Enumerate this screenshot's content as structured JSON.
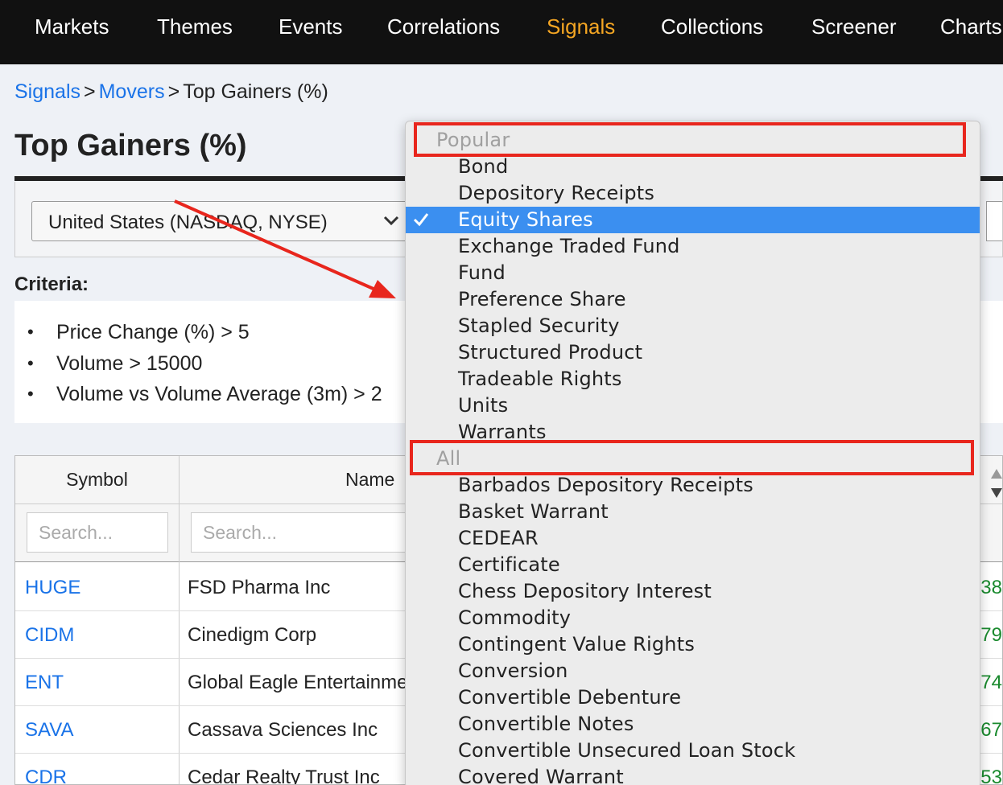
{
  "nav": {
    "items": [
      "Markets",
      "Themes",
      "Events",
      "Correlations",
      "Signals",
      "Collections",
      "Screener",
      "Charts"
    ],
    "active": "Signals",
    "active_color": "#f5a623"
  },
  "breadcrumb": {
    "signals": "Signals",
    "movers": "Movers",
    "sep": ">",
    "current": "Top Gainers (%)"
  },
  "page": {
    "title": "Top Gainers (%)"
  },
  "filters": {
    "market": "United States (NASDAQ, NYSE)"
  },
  "criteria": {
    "label": "Criteria:",
    "items": [
      "Price Change (%) > 5",
      "Volume > 15000",
      "Volume vs Volume Average (3m) > 2"
    ]
  },
  "table": {
    "headers": {
      "symbol": "Symbol",
      "name": "Name"
    },
    "search_placeholder": "Search...",
    "rows": [
      {
        "symbol": "HUGE",
        "name": "FSD Pharma Inc",
        "value": "38"
      },
      {
        "symbol": "CIDM",
        "name": "Cinedigm Corp",
        "value": "79"
      },
      {
        "symbol": "ENT",
        "name": "Global Eagle Entertainment",
        "value": "74"
      },
      {
        "symbol": "SAVA",
        "name": "Cassava Sciences Inc",
        "value": "67"
      },
      {
        "symbol": "CDR",
        "name": "Cedar Realty Trust Inc",
        "value": "53"
      }
    ]
  },
  "dropdown": {
    "groups": [
      {
        "label": "Popular",
        "items": [
          "Bond",
          "Depository Receipts",
          "Equity Shares",
          "Exchange Traded Fund",
          "Fund",
          "Preference Share",
          "Stapled Security",
          "Structured Product",
          "Tradeable Rights",
          "Units",
          "Warrants"
        ]
      },
      {
        "label": "All",
        "items": [
          "Barbados Depository Receipts",
          "Basket Warrant",
          "CEDEAR",
          "Certificate",
          "Chess Depository Interest",
          "Commodity",
          "Contingent Value Rights",
          "Conversion",
          "Convertible Debenture",
          "Convertible Notes",
          "Convertible Unsecured Loan Stock",
          "Covered Warrant"
        ]
      }
    ],
    "selected": "Equity Shares",
    "selected_color": "#3b8ff0"
  },
  "annotation_color": "#e8261d"
}
